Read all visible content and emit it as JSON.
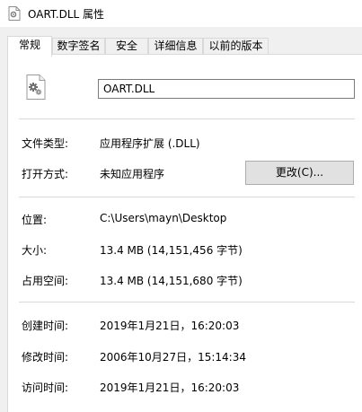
{
  "window": {
    "title": "OART.DLL 属性",
    "icon": "file-gear-icon"
  },
  "tabs": [
    {
      "label": "常规",
      "active": true
    },
    {
      "label": "数字签名",
      "active": false
    },
    {
      "label": "安全",
      "active": false
    },
    {
      "label": "详细信息",
      "active": false
    },
    {
      "label": "以前的版本",
      "active": false
    }
  ],
  "general": {
    "file_icon": "dll-file-icon",
    "file_name": "OART.DLL",
    "file_type_label": "文件类型:",
    "file_type_value": "应用程序扩展 (.DLL)",
    "opens_with_label": "打开方式:",
    "opens_with_value": "未知应用程序",
    "change_button": "更改(C)...",
    "location_label": "位置:",
    "location_value": "C:\\Users\\mayn\\Desktop",
    "size_label": "大小:",
    "size_value": "13.4 MB (14,151,456 字节)",
    "size_on_disk_label": "占用空间:",
    "size_on_disk_value": "13.4 MB (14,151,680 字节)",
    "created_label": "创建时间:",
    "created_value": "2019年1月21日，16:20:03",
    "modified_label": "修改时间:",
    "modified_value": "2006年10月27日，15:14:34",
    "accessed_label": "访问时间:",
    "accessed_value": "2019年1月21日，16:20:03"
  }
}
